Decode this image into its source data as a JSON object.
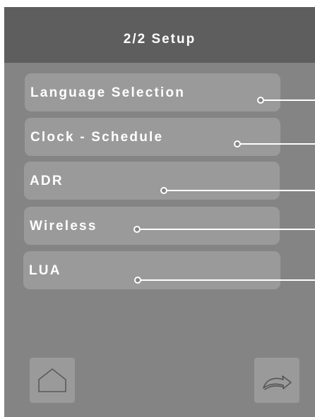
{
  "header": {
    "title": "2/2 Setup"
  },
  "menu": {
    "items": [
      {
        "label": "Language Selection"
      },
      {
        "label": "Clock - Schedule"
      },
      {
        "label": "ADR"
      },
      {
        "label": "Wireless"
      },
      {
        "label": "LUA"
      }
    ]
  },
  "nav": {
    "home_icon": "home-icon",
    "forward_icon": "forward-arrow-icon"
  },
  "colors": {
    "header": "#5e5e5e",
    "screen": "#848484",
    "button": "#9a9a9a",
    "text": "#ffffff"
  }
}
